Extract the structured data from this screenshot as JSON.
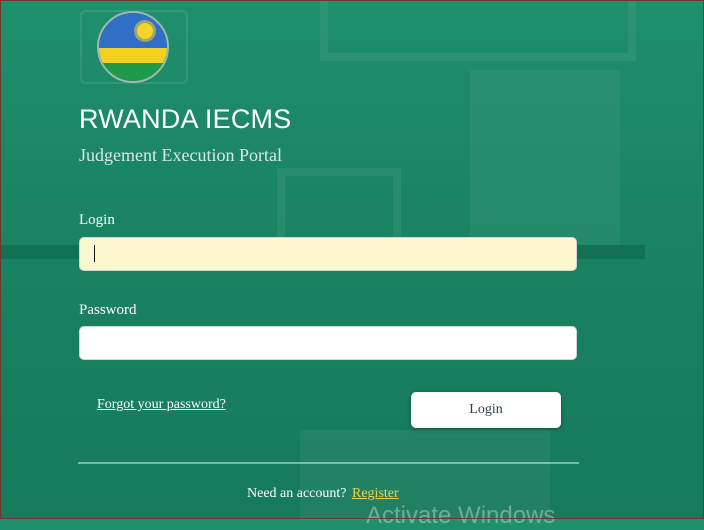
{
  "app": {
    "title": "RWANDA IECMS",
    "subtitle": "Judgement Execution Portal"
  },
  "form": {
    "login_label": "Login",
    "login_value": "",
    "password_label": "Password",
    "password_value": "",
    "forgot_link": "Forgot your password?",
    "submit_label": "Login"
  },
  "footer": {
    "account_text": "Need an account?",
    "register_link": "Register"
  },
  "overlay": {
    "watermark": "Activate Windows"
  },
  "icons": {
    "logo": "rwanda-flag-emblem-icon"
  },
  "colors": {
    "background": "#1a8463",
    "login_field": "#fbf7d0",
    "register_link": "#f2d04a",
    "button_text": "#23405a"
  }
}
